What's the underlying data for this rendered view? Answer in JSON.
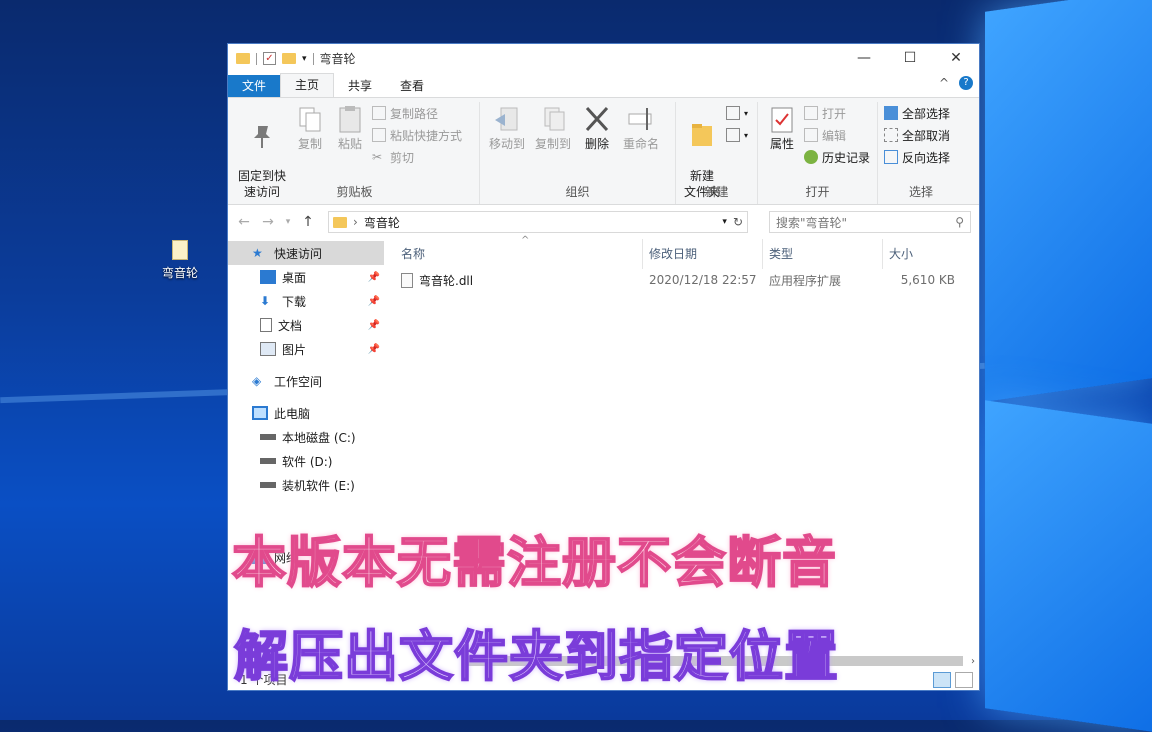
{
  "desktop": {
    "icon_label": "弯音轮"
  },
  "window": {
    "title": "弯音轮",
    "controls": {
      "minimize": "—",
      "maximize": "☐",
      "close": "✕"
    },
    "tabs": [
      "文件",
      "主页",
      "共享",
      "查看"
    ],
    "help": "?",
    "collapse": "^"
  },
  "ribbon": {
    "clipboard": {
      "label": "剪贴板",
      "pin_quick": "固定到快\n速访问",
      "copy": "复制",
      "paste": "粘贴",
      "copy_path": "复制路径",
      "paste_shortcut": "粘贴快捷方式",
      "cut": "剪切"
    },
    "organize": {
      "label": "组织",
      "move_to": "移动到",
      "copy_to": "复制到",
      "delete": "删除",
      "rename": "重命名"
    },
    "new": {
      "label": "新建",
      "new_folder": "新建\n文件夹"
    },
    "open": {
      "label": "打开",
      "properties": "属性",
      "open": "打开",
      "edit": "编辑",
      "history": "历史记录"
    },
    "select": {
      "label": "选择",
      "select_all": "全部选择",
      "select_none": "全部取消",
      "invert": "反向选择"
    }
  },
  "address": {
    "path": "弯音轮",
    "search_placeholder": "搜索\"弯音轮\""
  },
  "nav": [
    {
      "label": "快速访问",
      "pinned": false,
      "selected": true
    },
    {
      "label": "桌面",
      "pinned": true
    },
    {
      "label": "下载",
      "pinned": true
    },
    {
      "label": "文档",
      "pinned": true
    },
    {
      "label": "图片",
      "pinned": true
    },
    {
      "label": "工作空间"
    },
    {
      "label": "此电脑"
    },
    {
      "label": "本地磁盘 (C:)"
    },
    {
      "label": "软件 (D:)"
    },
    {
      "label": "装机软件 (E:)"
    },
    {
      "label": "网络"
    }
  ],
  "columns": {
    "name": "名称",
    "date": "修改日期",
    "type": "类型",
    "size": "大小"
  },
  "files": [
    {
      "name": "弯音轮.dll",
      "date": "2020/12/18 22:57",
      "type": "应用程序扩展",
      "size": "5,610 KB"
    }
  ],
  "status": {
    "count": "1 个项目"
  },
  "captions": {
    "line1": "本版本无需注册不会断音",
    "line2": "解压出文件夹到指定位置"
  },
  "colors": {
    "accent": "#1979ca",
    "caption1": "#e14a8c",
    "caption2": "#7a3cd9"
  }
}
